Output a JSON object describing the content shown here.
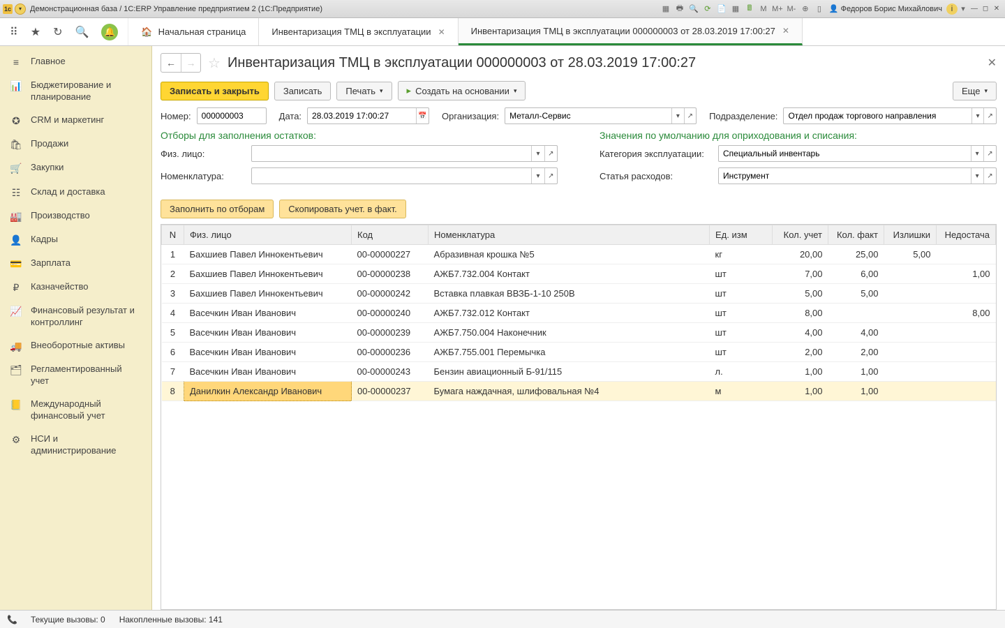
{
  "titlebar": {
    "title": "Демонстрационная база / 1С:ERP Управление предприятием 2  (1С:Предприятие)",
    "memory": {
      "m": "M",
      "m_plus": "M+",
      "m_minus": "M-"
    },
    "user": "Федоров Борис Михайлович"
  },
  "tabs": {
    "home": "Начальная страница",
    "list": "Инвентаризация ТМЦ в эксплуатации",
    "doc": "Инвентаризация ТМЦ в эксплуатации 000000003 от 28.03.2019 17:00:27"
  },
  "sidebar": [
    {
      "icon": "≡",
      "label": "Главное"
    },
    {
      "icon": "📊",
      "label": "Бюджетирование и планирование"
    },
    {
      "icon": "✪",
      "label": "CRM и маркетинг"
    },
    {
      "icon": "🛍",
      "label": "Продажи"
    },
    {
      "icon": "🛒",
      "label": "Закупки"
    },
    {
      "icon": "☷",
      "label": "Склад и доставка"
    },
    {
      "icon": "🏭",
      "label": "Производство"
    },
    {
      "icon": "👤",
      "label": "Кадры"
    },
    {
      "icon": "💳",
      "label": "Зарплата"
    },
    {
      "icon": "₽",
      "label": "Казначейство"
    },
    {
      "icon": "📈",
      "label": "Финансовый результат и контроллинг"
    },
    {
      "icon": "🚚",
      "label": "Внеоборотные активы"
    },
    {
      "icon": "🗂",
      "label": "Регламентированный учет"
    },
    {
      "icon": "📒",
      "label": "Международный финансовый учет"
    },
    {
      "icon": "⚙",
      "label": "НСИ и администрирование"
    }
  ],
  "doc": {
    "title": "Инвентаризация ТМЦ в эксплуатации 000000003 от 28.03.2019 17:00:27",
    "toolbar": {
      "save_close": "Записать и закрыть",
      "save": "Записать",
      "print": "Печать",
      "create_based": "Создать на основании",
      "more": "Еще"
    },
    "fields": {
      "number_label": "Номер:",
      "number": "000000003",
      "date_label": "Дата:",
      "date": "28.03.2019 17:00:27",
      "org_label": "Организация:",
      "org": "Металл-Сервис",
      "dept_label": "Подразделение:",
      "dept": "Отдел продаж торгового направления"
    },
    "filters": {
      "left_title": "Отборы для заполнения остатков:",
      "right_title": "Значения по умолчанию для оприходования и списания:",
      "person_label": "Физ. лицо:",
      "person": "",
      "nomen_label": "Номенклатура:",
      "nomen": "",
      "category_label": "Категория эксплуатации:",
      "category": "Специальный инвентарь",
      "expense_label": "Статья расходов:",
      "expense": "Инструмент"
    },
    "actions": {
      "fill": "Заполнить по отборам",
      "copy": "Скопировать учет. в факт."
    },
    "columns": {
      "n": "N",
      "person": "Физ. лицо",
      "code": "Код",
      "nomen": "Номенклатура",
      "unit": "Ед. изм",
      "qty_acc": "Кол. учет",
      "qty_fact": "Кол. факт",
      "surplus": "Излишки",
      "shortage": "Недостача"
    },
    "rows": [
      {
        "n": "1",
        "person": "Бахшиев Павел Иннокентьевич",
        "code": "00-00000227",
        "nomen": "Абразивная крошка №5",
        "unit": "кг",
        "qty_acc": "20,00",
        "qty_fact": "25,00",
        "surplus": "5,00",
        "shortage": ""
      },
      {
        "n": "2",
        "person": "Бахшиев Павел Иннокентьевич",
        "code": "00-00000238",
        "nomen": "АЖБ7.732.004 Контакт",
        "unit": "шт",
        "qty_acc": "7,00",
        "qty_fact": "6,00",
        "surplus": "",
        "shortage": "1,00"
      },
      {
        "n": "3",
        "person": "Бахшиев Павел Иннокентьевич",
        "code": "00-00000242",
        "nomen": "Вставка плавкая ВВЗБ-1-10 250В",
        "unit": "шт",
        "qty_acc": "5,00",
        "qty_fact": "5,00",
        "surplus": "",
        "shortage": ""
      },
      {
        "n": "4",
        "person": "Васечкин Иван Иванович",
        "code": "00-00000240",
        "nomen": "АЖБ7.732.012 Контакт",
        "unit": "шт",
        "qty_acc": "8,00",
        "qty_fact": "",
        "surplus": "",
        "shortage": "8,00"
      },
      {
        "n": "5",
        "person": "Васечкин Иван Иванович",
        "code": "00-00000239",
        "nomen": "АЖБ7.750.004 Наконечник",
        "unit": "шт",
        "qty_acc": "4,00",
        "qty_fact": "4,00",
        "surplus": "",
        "shortage": ""
      },
      {
        "n": "6",
        "person": "Васечкин Иван Иванович",
        "code": "00-00000236",
        "nomen": "АЖБ7.755.001 Перемычка",
        "unit": "шт",
        "qty_acc": "2,00",
        "qty_fact": "2,00",
        "surplus": "",
        "shortage": ""
      },
      {
        "n": "7",
        "person": "Васечкин Иван Иванович",
        "code": "00-00000243",
        "nomen": "Бензин авиационный Б-91/115",
        "unit": "л.",
        "qty_acc": "1,00",
        "qty_fact": "1,00",
        "surplus": "",
        "shortage": ""
      },
      {
        "n": "8",
        "person": "Данилкин Александр Иванович",
        "code": "00-00000237",
        "nomen": "Бумага наждачная, шлифовальная №4",
        "unit": "м",
        "qty_acc": "1,00",
        "qty_fact": "1,00",
        "surplus": "",
        "shortage": ""
      }
    ]
  },
  "statusbar": {
    "current_label": "Текущие вызовы:",
    "current_value": "0",
    "accum_label": "Накопленные вызовы:",
    "accum_value": "141"
  }
}
